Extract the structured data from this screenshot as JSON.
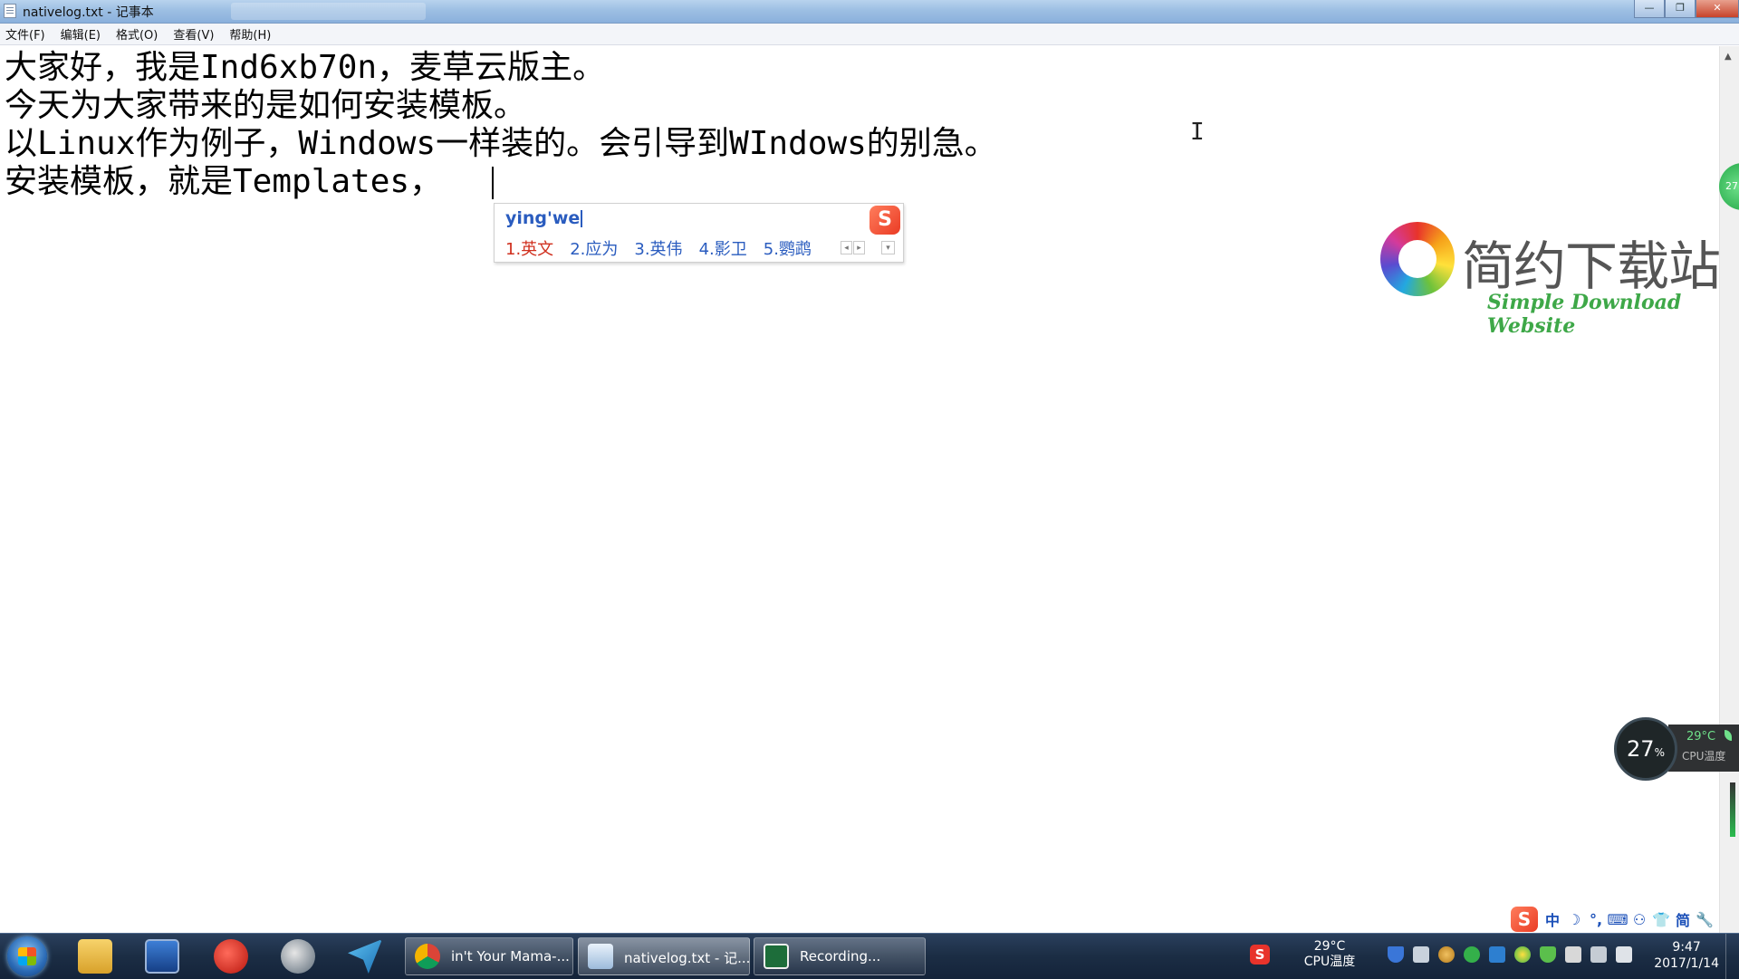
{
  "window": {
    "title": "nativelog.txt - 记事本",
    "minimize_glyph": "—",
    "restore_glyph": "❐",
    "close_glyph": "✕"
  },
  "menu": {
    "items": [
      "文件(F)",
      "编辑(E)",
      "格式(O)",
      "查看(V)",
      "帮助(H)"
    ]
  },
  "editor": {
    "lines": [
      "大家好，我是Ind6xb70n，麦草云版主。",
      "今天为大家带来的是如何安装模板。",
      "以Linux作为例子，Windows一样装的。会引导到WIndows的别急。",
      "安装模板，就是Templates，"
    ],
    "ibeam_glyph": "I"
  },
  "ime": {
    "pinyin": "ying'we",
    "logo_letter": "S",
    "candidates": [
      "1.英文",
      "2.应为",
      "3.英伟",
      "4.影卫",
      "5.鹦鹉"
    ],
    "prev_glyph": "◂",
    "next_glyph": "▸",
    "more_glyph": "▾"
  },
  "watermark": {
    "cn": "简约下载站",
    "en": "Simple Download Website"
  },
  "side_badge": {
    "text": "27"
  },
  "cpu_widget": {
    "percent": "27",
    "percent_unit": "%",
    "temp": "29°C",
    "label": "CPU温度"
  },
  "ime_status": {
    "logo_letter": "S",
    "items": [
      "中",
      "☽",
      "°,",
      "⌨",
      "⚇",
      "👕",
      "简",
      "🔧"
    ]
  },
  "taskbar": {
    "apps": [
      {
        "label": "in't Your Mama-..."
      },
      {
        "label": "nativelog.txt - 记..."
      },
      {
        "label": "Recording..."
      }
    ],
    "tray_logo_letter": "S",
    "tray_temp": "29°C",
    "tray_temp_label": "CPU温度",
    "clock_time": "9:47",
    "clock_date": "2017/1/14"
  },
  "colors": {
    "ime_candidate": "#2a5cbf",
    "ime_first_candidate": "#d0301f",
    "sogou_brand": "#ea3b24",
    "cpu_temp_green": "#6fe08a"
  }
}
